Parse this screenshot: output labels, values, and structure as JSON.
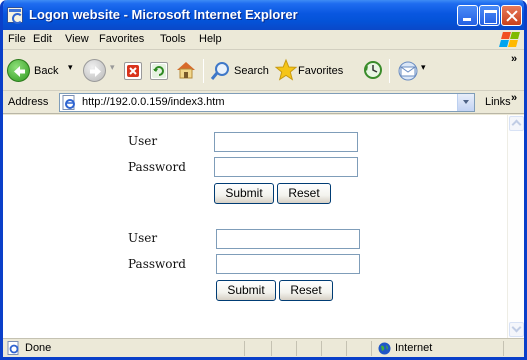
{
  "window": {
    "title": "Logon website - Microsoft Internet Explorer"
  },
  "menu": {
    "items": [
      "File",
      "Edit",
      "View",
      "Favorites",
      "Tools",
      "Help"
    ]
  },
  "toolbar": {
    "back_label": "Back",
    "search_label": "Search",
    "favorites_label": "Favorites"
  },
  "address": {
    "label": "Address",
    "url": "http://192.0.0.159/index3.htm",
    "links_label": "Links"
  },
  "forms": [
    {
      "user_label": "User",
      "user_value": "",
      "password_label": "Password",
      "password_value": "",
      "submit_label": "Submit",
      "reset_label": "Reset"
    },
    {
      "user_label": "User",
      "user_value": "",
      "password_label": "Password",
      "password_value": "",
      "submit_label": "Submit",
      "reset_label": "Reset"
    }
  ],
  "status": {
    "text": "Done",
    "zone": "Internet"
  },
  "colors": {
    "titlebar": "#0957e0",
    "chrome": "#ece9d8",
    "input_border": "#7f9db9",
    "button_border": "#003c74"
  }
}
